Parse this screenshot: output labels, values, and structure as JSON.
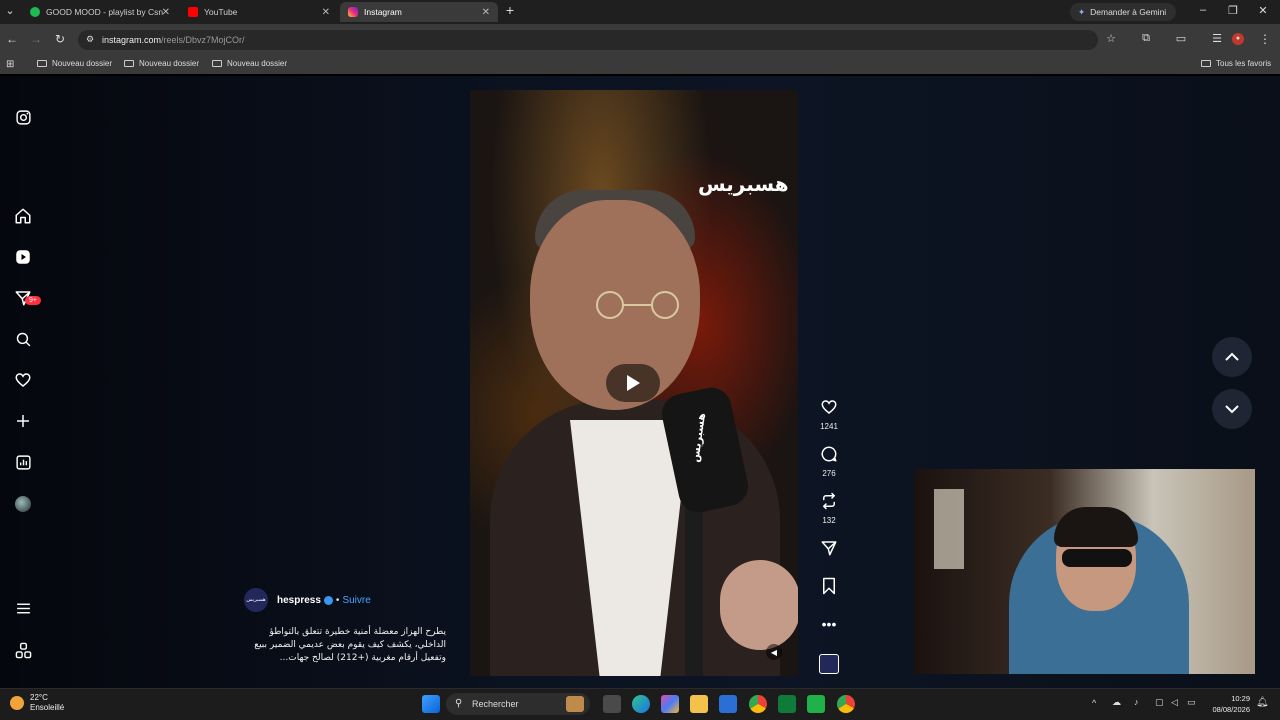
{
  "browser": {
    "tabs": [
      {
        "title": "GOOD MOOD - playlist by Csn",
        "color": "#1db954"
      },
      {
        "title": "YouTube",
        "color": "#ff0000"
      },
      {
        "title": "Instagram",
        "color": "#d6249f"
      }
    ],
    "gemini_label": "Demander à Gemini",
    "url_host": "instagram.com",
    "url_path": "/reels/Dbvz7MojCOr/",
    "bookmarks": [
      "Nouveau dossier",
      "Nouveau dossier",
      "Nouveau dossier"
    ],
    "all_bookmarks": "Tous les favoris"
  },
  "sidebar": {
    "icons": [
      "instagram-logo-icon",
      "home-icon",
      "reels-icon",
      "messages-icon",
      "search-icon",
      "notifications-icon",
      "create-icon",
      "dashboard-icon",
      "profile-avatar",
      "more-menu-icon",
      "threads-icon"
    ],
    "messages_badge": "9+"
  },
  "reel": {
    "watermark": "هسبريس",
    "mic_brand": "هسبريس",
    "author": "hespress",
    "author_avatar_text": "هسبريس",
    "follow": "Suivre",
    "separator": "•",
    "caption": "يطرح الهزاز معضلة أمنية خطيرة تتعلق بالتواطؤ الداخلي، يكشف كيف يقوم بعض عديمي الضمير ببيع وتفعيل أرقام مغربية (+212) لصالح جهات...",
    "likes": "1241",
    "comments": "276",
    "reposts": "132"
  },
  "taskbar": {
    "temperature": "22°C",
    "weather": "Ensoleillé",
    "search_placeholder": "Rechercher",
    "time": "10:29",
    "date": "08/08/2026"
  },
  "colors": {
    "accent_blue": "#4aa3ff",
    "badge_red": "#ff3040",
    "page_bg": "#0b1220"
  }
}
